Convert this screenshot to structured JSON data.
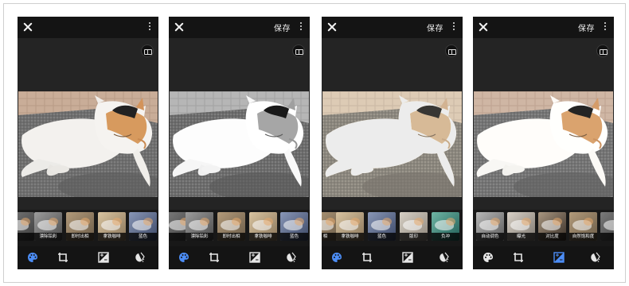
{
  "colors": {
    "accent": "#4c8df6",
    "inactive_icon": "#e6e6e6",
    "bar": "#141414",
    "canvas": "#242424"
  },
  "panels": [
    {
      "show_save": false,
      "save_label": "",
      "active_tool": "palette-icon",
      "photo_tone": "normal",
      "filters": [
        {
          "label": "",
          "tone": "gray",
          "selected": false
        },
        {
          "label": "漂除铅彩",
          "tone": "bw",
          "selected": false
        },
        {
          "label": "即时出相",
          "tone": "warm",
          "selected": false
        },
        {
          "label": "拿铁咖啡",
          "tone": "latte",
          "selected": false
        },
        {
          "label": "蓝色",
          "tone": "blue",
          "selected": false
        }
      ]
    },
    {
      "show_save": true,
      "save_label": "保存",
      "active_tool": "palette-icon",
      "photo_tone": "bw",
      "filters": [
        {
          "label": "",
          "tone": "gray",
          "selected": false
        },
        {
          "label": "漂除铅彩",
          "tone": "bw",
          "selected": true
        },
        {
          "label": "即时出相",
          "tone": "warm",
          "selected": false
        },
        {
          "label": "拿铁咖啡",
          "tone": "latte",
          "selected": false
        },
        {
          "label": "蓝色",
          "tone": "blue",
          "selected": false
        }
      ]
    },
    {
      "show_save": true,
      "save_label": "保存",
      "active_tool": "palette-icon",
      "photo_tone": "faded",
      "filters": [
        {
          "label": "相",
          "tone": "warm",
          "selected": false
        },
        {
          "label": "拿铁咖啡",
          "tone": "latte",
          "selected": false
        },
        {
          "label": "蓝色",
          "tone": "blue",
          "selected": false
        },
        {
          "label": "版印",
          "tone": "faded",
          "selected": true
        },
        {
          "label": "负冲",
          "tone": "teal",
          "selected": false
        }
      ]
    },
    {
      "show_save": true,
      "save_label": "保存",
      "active_tool": "adjust-icon",
      "photo_tone": "soft",
      "filters": [
        {
          "label": "自动调色",
          "tone": "auto",
          "selected": true
        },
        {
          "label": "曝光",
          "tone": "expo",
          "selected": false
        },
        {
          "label": "对比度",
          "tone": "contrast",
          "selected": false
        },
        {
          "label": "自然饱和度",
          "tone": "warm",
          "selected": false
        },
        {
          "label": "",
          "tone": "gray",
          "selected": false
        }
      ]
    }
  ],
  "tools": [
    "palette-icon",
    "crop-icon",
    "adjust-icon",
    "healing-icon"
  ]
}
